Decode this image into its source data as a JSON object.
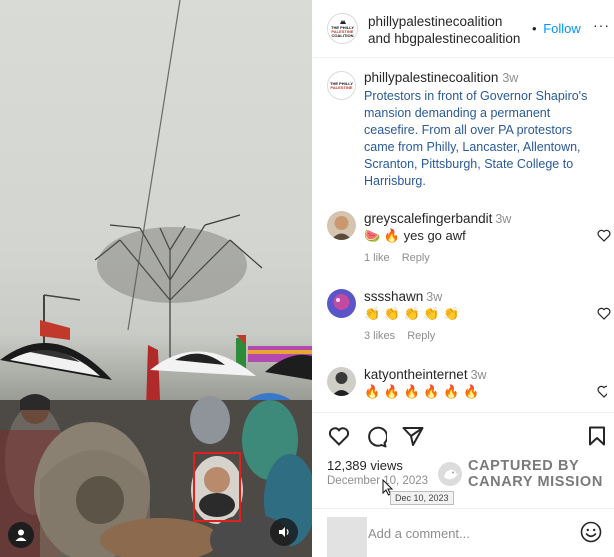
{
  "header": {
    "author1": "phillypalestinecoalition",
    "connector": "and",
    "author2": "hbgpalestinecoalition",
    "separator": "•",
    "follow_label": "Follow",
    "more_label": "···",
    "logo_text": [
      "THE PHILLY",
      "PALESTINE",
      "COALITION"
    ]
  },
  "caption": {
    "username": "phillypalestinecoalition",
    "time": "3w",
    "text": "Protestors in front of Governor Shapiro's mansion demanding a permanent ceasefire. From all over PA protestors came from Philly, Lancaster, Allentown, Scranton, Pittsburgh, State College to Harrisburg."
  },
  "comments": [
    {
      "username": "greyscalefingerbandit",
      "time": "3w",
      "text": "🍉 🔥 yes go awf",
      "likes": "1 like",
      "reply": "Reply"
    },
    {
      "username": "sssshawn",
      "time": "3w",
      "text": "👏 👏 👏 👏 👏",
      "likes": "3 likes",
      "reply": "Reply"
    },
    {
      "username": "katyontheinternet",
      "time": "3w",
      "text": "🔥 🔥 🔥 🔥 🔥 🔥",
      "likes": "",
      "reply": ""
    }
  ],
  "post_stats": {
    "views": "12,389 views",
    "date": "December 10, 2023",
    "tooltip": "Dec 10, 2023"
  },
  "watermark": {
    "line1": "CAPTURED BY",
    "line2": "CANARY MISSION"
  },
  "add_comment": {
    "placeholder": "Add a comment..."
  },
  "colors": {
    "link_blue": "#0095f6",
    "caption_text": "#2a5a9a",
    "muted": "#8e8e8e",
    "highlight_box": "#e0201d"
  },
  "icons": {
    "like": "heart-icon",
    "comment": "comment-icon",
    "share": "share-icon",
    "save": "bookmark-icon",
    "emoji": "emoji-icon",
    "sound": "speaker-icon",
    "user": "user-icon"
  }
}
